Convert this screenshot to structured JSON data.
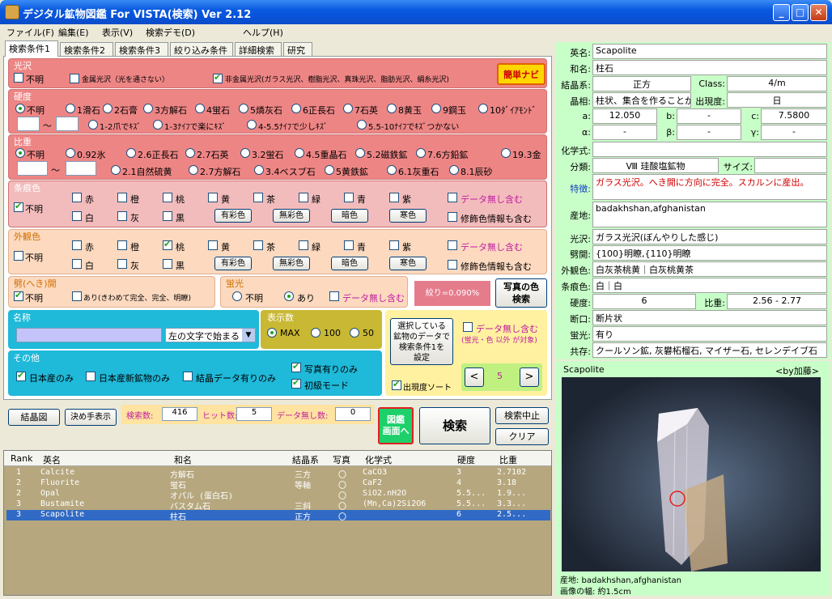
{
  "window": {
    "title": "デジタル鉱物図鑑 For VISTA(検索)  Ver 2.12",
    "min": "_",
    "max": "□",
    "close": "✕"
  },
  "menu": [
    "ファイル(F)",
    "編集(E)",
    "表示(V)",
    "検索デモ(D)",
    "ヘルプ(H)"
  ],
  "tabs": [
    "検索条件1",
    "検索条件2",
    "検索条件3",
    "絞り込み条件",
    "詳細検索",
    "研究"
  ],
  "luster": {
    "title": "光沢",
    "unknown": "不明",
    "metal": "金属光沢（光を通さない）",
    "nonmetal": "非金属光沢(ガラス光沢、樹脂光沢、真珠光沢、脂肪光沢、絹糸光沢)",
    "navi": "簡単ナビ"
  },
  "hardness": {
    "title": "硬度",
    "opts": [
      "不明",
      "1滑石",
      "2石膏",
      "3方解石",
      "4蛍石",
      "5燐灰石",
      "6正長石",
      "7石英",
      "8黄玉",
      "9鋼玉",
      "10ﾀﾞｲｱﾓﾝﾄﾞ"
    ],
    "tilde": "～",
    "range": [
      "1-2爪でｷｽﾞ",
      "1-3ﾅｲﾌで楽にｷｽﾞ",
      "4-5.5ﾅｲﾌで少しｷｽﾞ",
      "5.5-10ﾅｲﾌでｷｽﾞつかない"
    ]
  },
  "gravity": {
    "title": "比重",
    "opts1": [
      "不明",
      "0.92氷",
      "2.6正長石",
      "2.7石英",
      "3.2蛍石",
      "4.5重晶石",
      "5.2磁鉄鉱",
      "7.6方鉛鉱",
      "19.3金"
    ],
    "tilde": "～",
    "opts2": [
      "2.1自然硫黄",
      "2.7方解石",
      "3.4ベスブ石",
      "5黄鉄鉱",
      "6.1灰重石",
      "8.1辰砂"
    ]
  },
  "streak": {
    "title": "条痕色",
    "unknown": "不明",
    "colors1": [
      "赤",
      "橙",
      "桃",
      "黄",
      "茶",
      "緑",
      "青",
      "紫"
    ],
    "colors2": [
      "白",
      "灰",
      "黒"
    ],
    "btns": [
      "有彩色",
      "無彩色",
      "暗色",
      "寒色"
    ],
    "nodata": "データ無し含む",
    "mod": "修飾色情報も含む"
  },
  "appear": {
    "title": "外観色",
    "unknown": "不明",
    "colors1": [
      "赤",
      "橙",
      "桃",
      "黄",
      "茶",
      "緑",
      "青",
      "紫"
    ],
    "colors2": [
      "白",
      "灰",
      "黒"
    ],
    "btns": [
      "有彩色",
      "無彩色",
      "暗色",
      "寒色"
    ],
    "nodata": "データ無し含む",
    "mod": "修飾色情報も含む"
  },
  "cleav": {
    "title": "劈(へき)開",
    "unknown": "不明",
    "yes": "あり(きわめて完全、完全、明瞭)"
  },
  "fluor": {
    "title": "蛍光",
    "unknown": "不明",
    "yes": "あり",
    "nodata": "データ無し含む"
  },
  "ratio": "絞り=0.090%",
  "photobtn": "写真の色\n検索",
  "name": {
    "title": "名称",
    "select": "左の文字で始まる",
    "arrow": "▼"
  },
  "count": {
    "title": "表示数",
    "opts": [
      "MAX",
      "100",
      "50"
    ]
  },
  "setbtn": "選択している\n鉱物のデータで\n検索条件1を\n設定",
  "sort": "出現度ソート",
  "nodata2": {
    "label": "データ無し含む",
    "note": "(蛍光・色 以外 が対象)"
  },
  "pager": {
    "prev": "<",
    "page": "5",
    "next": ">"
  },
  "other": {
    "title": "その他",
    "opts": [
      "日本産のみ",
      "日本産新鉱物のみ",
      "結晶データ有りのみ",
      "写真有りのみ",
      "初級モード"
    ]
  },
  "bottom": {
    "crystal": "結晶図",
    "handshow": "決め手表示",
    "searchCount": "検索数:",
    "searchVal": "416",
    "hitCount": "ヒット数:",
    "hitVal": "5",
    "noData": "データ無し数:",
    "noDataVal": "0",
    "zukan": "図鑑\n画面へ",
    "search": "検索",
    "stop": "検索中止",
    "clear": "クリア"
  },
  "table": {
    "headers": [
      "Rank",
      "英名",
      "和名",
      "結晶系",
      "写真",
      "化学式",
      "硬度",
      "比重"
    ],
    "rows": [
      [
        "1",
        "Calcite",
        "方解石",
        "三方",
        "〇",
        "CaCO3",
        "3",
        "2.7102"
      ],
      [
        "2",
        "Fluorite",
        "蛍石",
        "等軸",
        "〇",
        "CaF2",
        "4",
        "3.18"
      ],
      [
        "2",
        "Opal",
        "オパル (蛋白石)",
        "",
        "〇",
        "SiO2.nH2O",
        "5.5...",
        "1.9..."
      ],
      [
        "3",
        "Bustamite",
        "バスタム石",
        "三斜",
        "〇",
        "(Mn,Ca)2Si2O6",
        "5.5...",
        "3.3..."
      ],
      [
        "3",
        "Scapolite",
        "柱石",
        "正方",
        "〇",
        "",
        "6",
        "2.5..."
      ]
    ]
  },
  "detail": {
    "en": [
      "英名:",
      "Scapolite"
    ],
    "ja": [
      "和名:",
      "柱石"
    ],
    "sys": [
      "結晶系:",
      "正方"
    ],
    "cls": [
      "Class:",
      "4/m"
    ],
    "habit": [
      "晶相:",
      "柱状、集合を作ることが多"
    ],
    "freq": [
      "出現度:",
      "日"
    ],
    "a": [
      "a:",
      "12.050"
    ],
    "b": [
      "b:",
      "-"
    ],
    "c": [
      "c:",
      "7.5800"
    ],
    "al": [
      "α:",
      "-"
    ],
    "be": [
      "β:",
      "-"
    ],
    "ga": [
      "γ:",
      "-"
    ],
    "chem": [
      "化学式:",
      ""
    ],
    "cat": [
      "分類:",
      "Ⅷ 珪酸塩鉱物"
    ],
    "size": [
      "サイズ:",
      ""
    ],
    "feat": [
      "特徴:",
      "ガラス光沢。へき開に方向に完全。スカルンに産出。"
    ],
    "loc": [
      "産地:",
      "badakhshan,afghanistan"
    ],
    "lus": [
      "光沢:",
      "ガラス光沢(ぼんやりした感じ)"
    ],
    "clv": [
      "劈開:",
      "{100}明瞭,{110}明瞭"
    ],
    "app": [
      "外観色:",
      "白灰茶桃黄｜白灰桃黄茶"
    ],
    "str": [
      "条痕色:",
      "白｜白"
    ],
    "hard": [
      "硬度:",
      "6"
    ],
    "grav": [
      "比重:",
      "2.56 - 2.77"
    ],
    "frac": [
      "断口:",
      "断片状"
    ],
    "flu": [
      "蛍光:",
      "有り"
    ],
    "coex": [
      "共存:",
      "クールソン鉱, 灰礬柘榴石, マイザー石, セレンデイブ石"
    ]
  },
  "photo": {
    "name": "Scapolite",
    "credit": "<by加藤>",
    "loc": "産地: badakhshan,afghanistan",
    "width": "画像の幅: 約1.5cm"
  }
}
